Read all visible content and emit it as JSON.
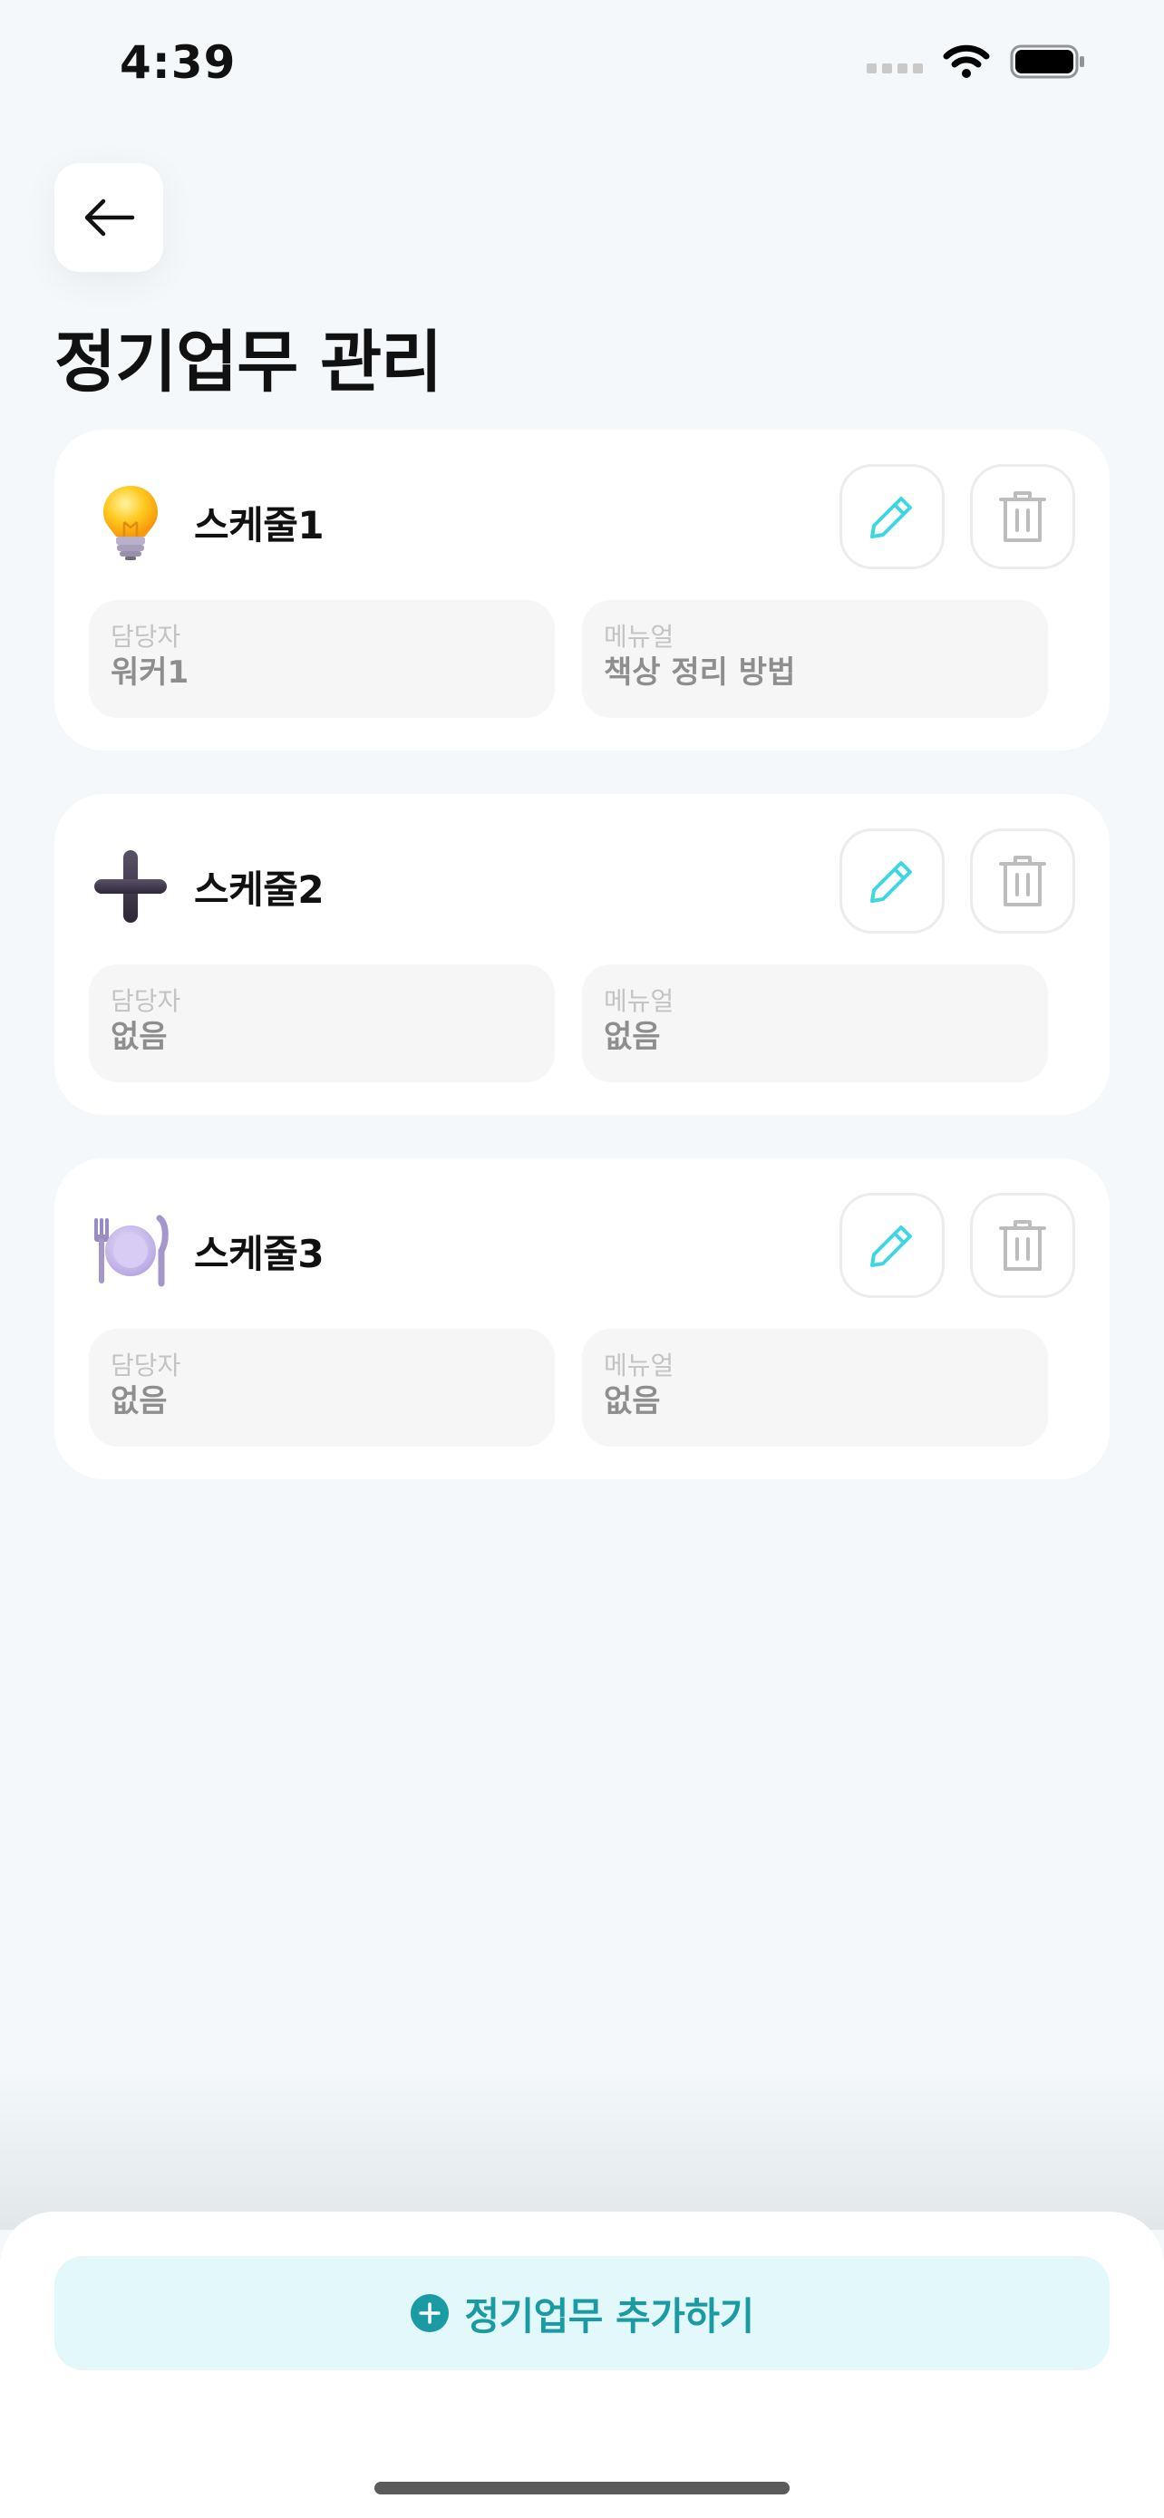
{
  "status_bar": {
    "time": "4:39"
  },
  "header": {
    "back_icon": "arrow-left-icon",
    "title": "정기업무 관리"
  },
  "schedules": [
    {
      "icon": "lightbulb-icon",
      "name": "스케줄1",
      "assignee_label": "담당자",
      "assignee": "워커1",
      "manual_label": "메뉴얼",
      "manual": "책상 정리 방법"
    },
    {
      "icon": "plus-icon",
      "name": "스케줄2",
      "assignee_label": "담당자",
      "assignee": "없음",
      "manual_label": "메뉴얼",
      "manual": "없음"
    },
    {
      "icon": "plate-cutlery-icon",
      "name": "스케줄3",
      "assignee_label": "담당자",
      "assignee": "없음",
      "manual_label": "메뉴얼",
      "manual": "없음"
    }
  ],
  "actions": {
    "edit_icon": "pencil-icon",
    "delete_icon": "trash-icon"
  },
  "footer": {
    "add_label": "정기업무 추가하기"
  },
  "colors": {
    "accent": "#1a9aa3",
    "edit_icon": "#3fd6e4",
    "add_bg": "#e2f8fa",
    "background": "#f4f8fa"
  }
}
